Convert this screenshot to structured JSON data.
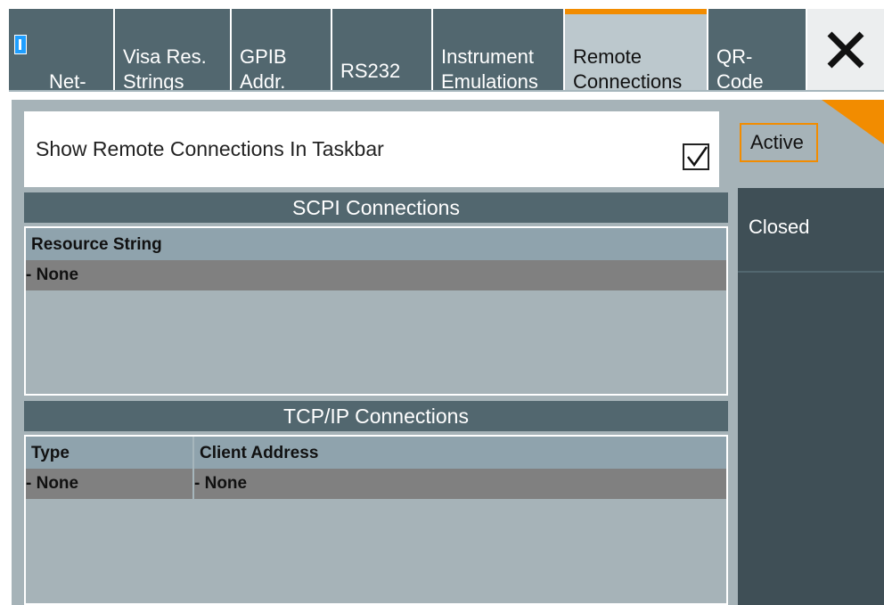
{
  "tabs": [
    {
      "label": "Net-\nwork",
      "info_icon": "info-icon"
    },
    {
      "label": "Visa Res.\nStrings"
    },
    {
      "label": "GPIB\nAddr."
    },
    {
      "label": "RS232"
    },
    {
      "label": "Instrument\nEmulations"
    },
    {
      "label": "Remote\nConnections",
      "active": true
    },
    {
      "label": "QR-\nCode"
    }
  ],
  "close_icon": "close-icon",
  "show_in_taskbar": {
    "label": "Show Remote Connections In Taskbar",
    "checked": true
  },
  "scpi": {
    "title": "SCPI Connections",
    "columns": [
      "Resource String"
    ],
    "rows": [
      [
        "- None"
      ]
    ]
  },
  "tcpip": {
    "title": "TCP/IP Connections",
    "columns": [
      "Type",
      "Client Address"
    ],
    "rows": [
      [
        "- None",
        "- None"
      ]
    ]
  },
  "side": {
    "active_label": "Active",
    "closed_label": "Closed"
  },
  "colors": {
    "accent": "#f28c00",
    "tab_bg": "#52676f",
    "active_tab_bg": "#bcc8cd",
    "panel_bg": "#a6b3b8",
    "info_blue": "#1f9fff"
  }
}
